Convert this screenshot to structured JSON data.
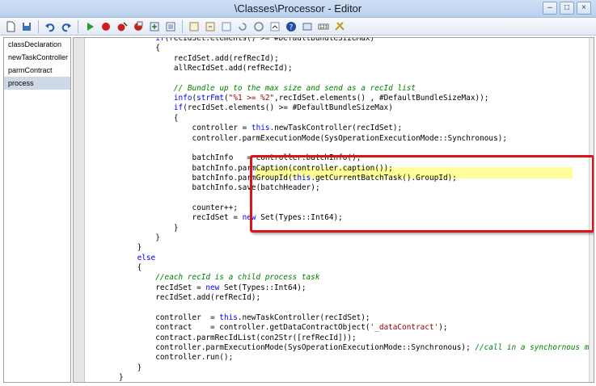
{
  "window": {
    "title": "\\Classes\\Processor - Editor",
    "controls": [
      "minimize",
      "maximize",
      "close"
    ]
  },
  "toolbar": {
    "icons": [
      "new-icon",
      "save-icon",
      "undo-icon",
      "redo-icon",
      "run-icon",
      "breakpoint-icon",
      "remove-breakpoints-icon",
      "compile-icon",
      "lookup-icon",
      "find-icon",
      "replace-icon",
      "goto-icon",
      "comment-icon",
      "uncomment-icon",
      "indent-icon",
      "outdent-icon",
      "help-icon",
      "script-icon",
      "number-icon",
      "tools-icon"
    ]
  },
  "sidebar": {
    "items": [
      {
        "label": "classDeclaration"
      },
      {
        "label": "newTaskController"
      },
      {
        "label": "parmContract"
      },
      {
        "label": "process"
      }
    ],
    "selected": "process"
  },
  "code": {
    "lines": [
      {
        "text": "if(recIdSet.elements() >= #DefaultBundleSizeMax)",
        "indent": 8,
        "clipped": true
      },
      {
        "text": "{",
        "indent": 8
      },
      {
        "text": "recIdSet.add(refRecId);",
        "indent": 12
      },
      {
        "text": "allRecIdSet.add(refRecId);",
        "indent": 12
      },
      {
        "text": "",
        "indent": 0
      },
      {
        "text": "// Bundle up to the max size and send as a recId list",
        "indent": 12,
        "type": "comment"
      },
      {
        "text": "info(strFmt(\"%1 >= %2\",recIdSet.elements() , #DefaultBundleSizeMax));",
        "indent": 12
      },
      {
        "text": "if(recIdSet.elements() >= #DefaultBundleSizeMax)",
        "indent": 12
      },
      {
        "text": "{",
        "indent": 12
      },
      {
        "text": "controller = this.newTaskController(recIdSet);",
        "indent": 16
      },
      {
        "text": "controller.parmExecutionMode(SysOperationExecutionMode::Synchronous);",
        "indent": 16,
        "highlight": true
      },
      {
        "text": "",
        "indent": 0
      },
      {
        "text": "batchInfo   = controller.batchInfo();",
        "indent": 16
      },
      {
        "text": "batchInfo.parmCaption(controller.caption());",
        "indent": 16
      },
      {
        "text": "batchInfo.parmGroupId(this.getCurrentBatchTask().GroupId);",
        "indent": 16
      },
      {
        "text": "batchInfo.save(batchHeader);",
        "indent": 16
      },
      {
        "text": "",
        "indent": 0
      },
      {
        "text": "counter++;",
        "indent": 16
      },
      {
        "text": "recIdSet = new Set(Types::Int64);",
        "indent": 16
      },
      {
        "text": "}",
        "indent": 12
      },
      {
        "text": "}",
        "indent": 8
      },
      {
        "text": "}",
        "indent": 4
      },
      {
        "text": "else",
        "indent": 4
      },
      {
        "text": "{",
        "indent": 4
      },
      {
        "text": "//each recId is a child process task",
        "indent": 8,
        "type": "comment"
      },
      {
        "text": "recIdSet = new Set(Types::Int64);",
        "indent": 8
      },
      {
        "text": "recIdSet.add(refRecId);",
        "indent": 8
      },
      {
        "text": "",
        "indent": 0
      },
      {
        "text": "controller  = this.newTaskController(recIdSet);",
        "indent": 8
      },
      {
        "text": "contract    = controller.getDataContractObject('_dataContract');",
        "indent": 8
      },
      {
        "text": "contract.parmRecIdList(con2Str([refRecId]));",
        "indent": 8
      },
      {
        "text": "controller.parmExecutionMode(SysOperationExecutionMode::Synchronous); //call in a synchornous mode.",
        "indent": 8
      },
      {
        "text": "controller.run();",
        "indent": 8
      },
      {
        "text": "}",
        "indent": 4
      },
      {
        "text": "}",
        "indent": 0
      }
    ]
  },
  "colors": {
    "keyword": "#0000ff",
    "string": "#8b0000",
    "comment": "#008000",
    "highlight": "#ffff99",
    "annotation_box": "#d9141b"
  }
}
